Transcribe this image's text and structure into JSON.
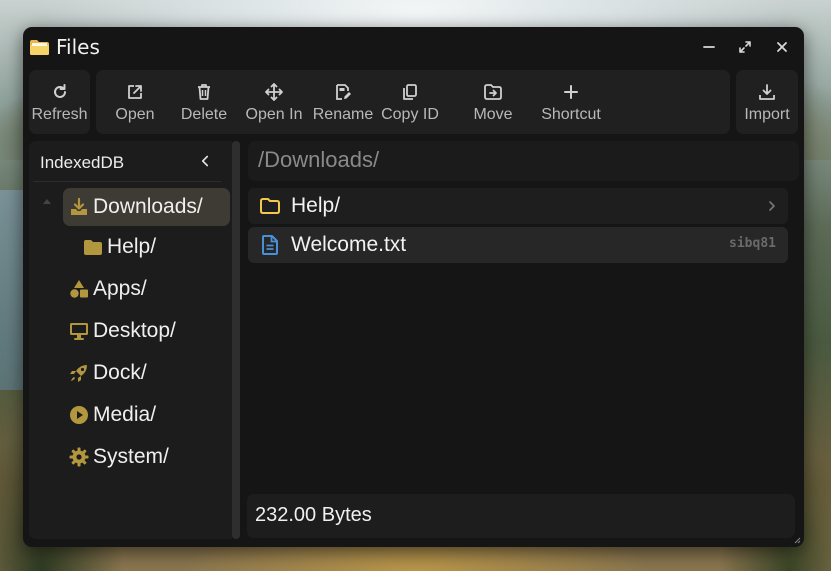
{
  "window": {
    "title": "Files",
    "icon": "folder-icon"
  },
  "window_controls": {
    "minimize": "minimize-icon",
    "maximize": "maximize-icon",
    "close": "close-icon"
  },
  "toolbar": {
    "refresh_label": "Refresh",
    "open_label": "Open",
    "delete_label": "Delete",
    "open_in_label": "Open In",
    "rename_label": "Rename",
    "copy_id_label": "Copy ID",
    "move_label": "Move",
    "shortcut_label": "Shortcut",
    "import_label": "Import"
  },
  "sidebar": {
    "title": "IndexedDB",
    "items": [
      {
        "label": "Downloads/",
        "icon": "download-icon",
        "active": true
      },
      {
        "label": "Help/",
        "icon": "folder-icon",
        "nested": true
      },
      {
        "label": "Apps/",
        "icon": "shapes-icon"
      },
      {
        "label": "Desktop/",
        "icon": "monitor-icon"
      },
      {
        "label": "Dock/",
        "icon": "rocket-icon"
      },
      {
        "label": "Media/",
        "icon": "play-circle-icon"
      },
      {
        "label": "System/",
        "icon": "gear-icon"
      }
    ]
  },
  "path": "/Downloads/",
  "files": [
    {
      "name": "Help/",
      "type": "folder",
      "icon": "folder-outline-icon"
    },
    {
      "name": "Welcome.txt",
      "type": "file",
      "icon": "document-icon",
      "id": "sibq81"
    }
  ],
  "status": {
    "size": "232.00 Bytes"
  },
  "colors": {
    "accent_gold": "#b3973f",
    "folder_yellow": "#f2c94c",
    "file_blue": "#4a90d9",
    "window_bg": "#151515",
    "panel_bg": "#1c1c1c",
    "active_item_bg": "#3e3a34"
  }
}
